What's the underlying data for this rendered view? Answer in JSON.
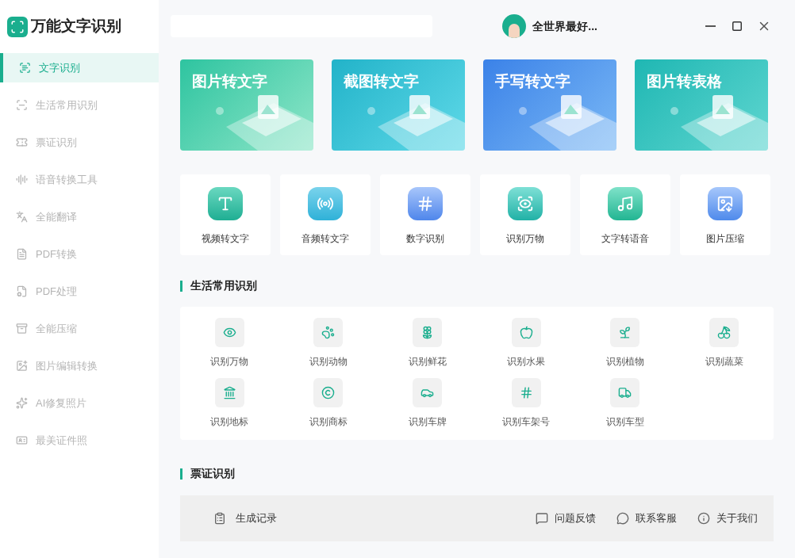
{
  "app": {
    "title": "万能文字识别"
  },
  "sidebar": {
    "items": [
      {
        "label": "文字识别",
        "selected": true
      },
      {
        "label": "生活常用识别",
        "selected": false
      },
      {
        "label": "票证识别",
        "selected": false
      },
      {
        "label": "语音转换工具",
        "selected": false
      },
      {
        "label": "全能翻译",
        "selected": false
      },
      {
        "label": "PDF转换",
        "selected": false
      },
      {
        "label": "PDF处理",
        "selected": false
      },
      {
        "label": "全能压缩",
        "selected": false
      },
      {
        "label": "图片编辑转换",
        "selected": false
      },
      {
        "label": "AI修复照片",
        "selected": false
      },
      {
        "label": "最美证件照",
        "selected": false
      }
    ]
  },
  "user": {
    "name": "全世界最好..."
  },
  "banners": [
    {
      "title": "图片转文字"
    },
    {
      "title": "截图转文字"
    },
    {
      "title": "手写转文字"
    },
    {
      "title": "图片转表格"
    }
  ],
  "tools": [
    {
      "label": "视频转文字"
    },
    {
      "label": "音频转文字"
    },
    {
      "label": "数字识别"
    },
    {
      "label": "识别万物"
    },
    {
      "label": "文字转语音"
    },
    {
      "label": "图片压缩"
    }
  ],
  "life_section": {
    "title": "生活常用识别",
    "items": [
      {
        "label": "识别万物"
      },
      {
        "label": "识别动物"
      },
      {
        "label": "识别鲜花"
      },
      {
        "label": "识别水果"
      },
      {
        "label": "识别植物"
      },
      {
        "label": "识别蔬菜"
      },
      {
        "label": "识别地标"
      },
      {
        "label": "识别商标"
      },
      {
        "label": "识别车牌"
      },
      {
        "label": "识别车架号"
      },
      {
        "label": "识别车型"
      }
    ]
  },
  "ticket_section": {
    "title": "票证识别"
  },
  "bottom_bar": {
    "left": "生成记录",
    "right": [
      "问题反馈",
      "联系客服",
      "关于我们"
    ]
  }
}
